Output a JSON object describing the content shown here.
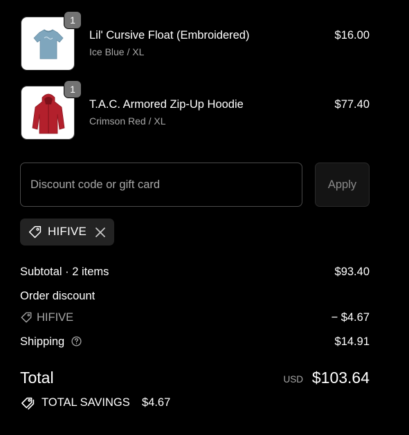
{
  "line_items": [
    {
      "name": "Lil' Cursive Float (Embroidered)",
      "variant": "Ice Blue / XL",
      "price": "$16.00",
      "quantity": "1",
      "color": "#7fa6bd"
    },
    {
      "name": "T.A.C. Armored Zip-Up Hoodie",
      "variant": "Crimson Red / XL",
      "price": "$77.40",
      "quantity": "1",
      "color": "#b3202c"
    }
  ],
  "discount": {
    "placeholder": "Discount code or gift card",
    "value": "",
    "apply_label": "Apply",
    "applied_code": "HIFIVE"
  },
  "summary": {
    "subtotal_label": "Subtotal · 2 items",
    "subtotal_value": "$93.40",
    "order_discount_label": "Order discount",
    "discount_code": "HIFIVE",
    "discount_value": "− $4.67",
    "shipping_label": "Shipping",
    "shipping_value": "$14.91",
    "total_label": "Total",
    "currency": "USD",
    "total_value": "$103.64",
    "savings_label": "TOTAL SAVINGS",
    "savings_value": "$4.67"
  },
  "icons": {
    "tag": "tag-icon",
    "close": "close-icon",
    "help": "question-circle-icon",
    "savings": "tags-icon"
  },
  "colors": {
    "background": "#000000",
    "text": "#ffffff",
    "muted": "#a8a8a8",
    "chip": "#232323",
    "badge": "#737373"
  }
}
